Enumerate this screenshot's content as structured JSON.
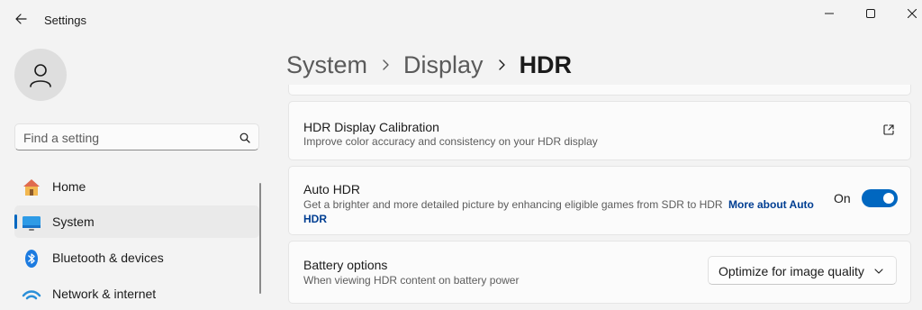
{
  "window": {
    "title": "Settings"
  },
  "profile": {
    "avatar_icon": "person-icon"
  },
  "search": {
    "placeholder": "Find a setting",
    "value": ""
  },
  "sidebar": {
    "items": [
      {
        "label": "Home",
        "icon": "home-icon",
        "selected": false
      },
      {
        "label": "System",
        "icon": "system-display-icon",
        "selected": true
      },
      {
        "label": "Bluetooth & devices",
        "icon": "bluetooth-icon",
        "selected": false
      },
      {
        "label": "Network & internet",
        "icon": "wifi-icon",
        "selected": false
      }
    ]
  },
  "breadcrumb": {
    "items": [
      "System",
      "Display"
    ],
    "current": "HDR"
  },
  "cards": {
    "calibration": {
      "title": "HDR Display Calibration",
      "description": "Improve color accuracy and consistency on your HDR display"
    },
    "auto_hdr": {
      "title": "Auto HDR",
      "description": "Get a brighter and more detailed picture by enhancing eligible games from SDR to HDR",
      "link_part1": "More about Auto",
      "link_part2": "HDR",
      "toggle_state_label": "On",
      "toggle_on": true
    },
    "battery": {
      "title": "Battery options",
      "description": "When viewing HDR content on battery power",
      "dropdown_value": "Optimize for image quality"
    }
  },
  "colors": {
    "accent": "#0067c0",
    "link": "#003e92"
  }
}
